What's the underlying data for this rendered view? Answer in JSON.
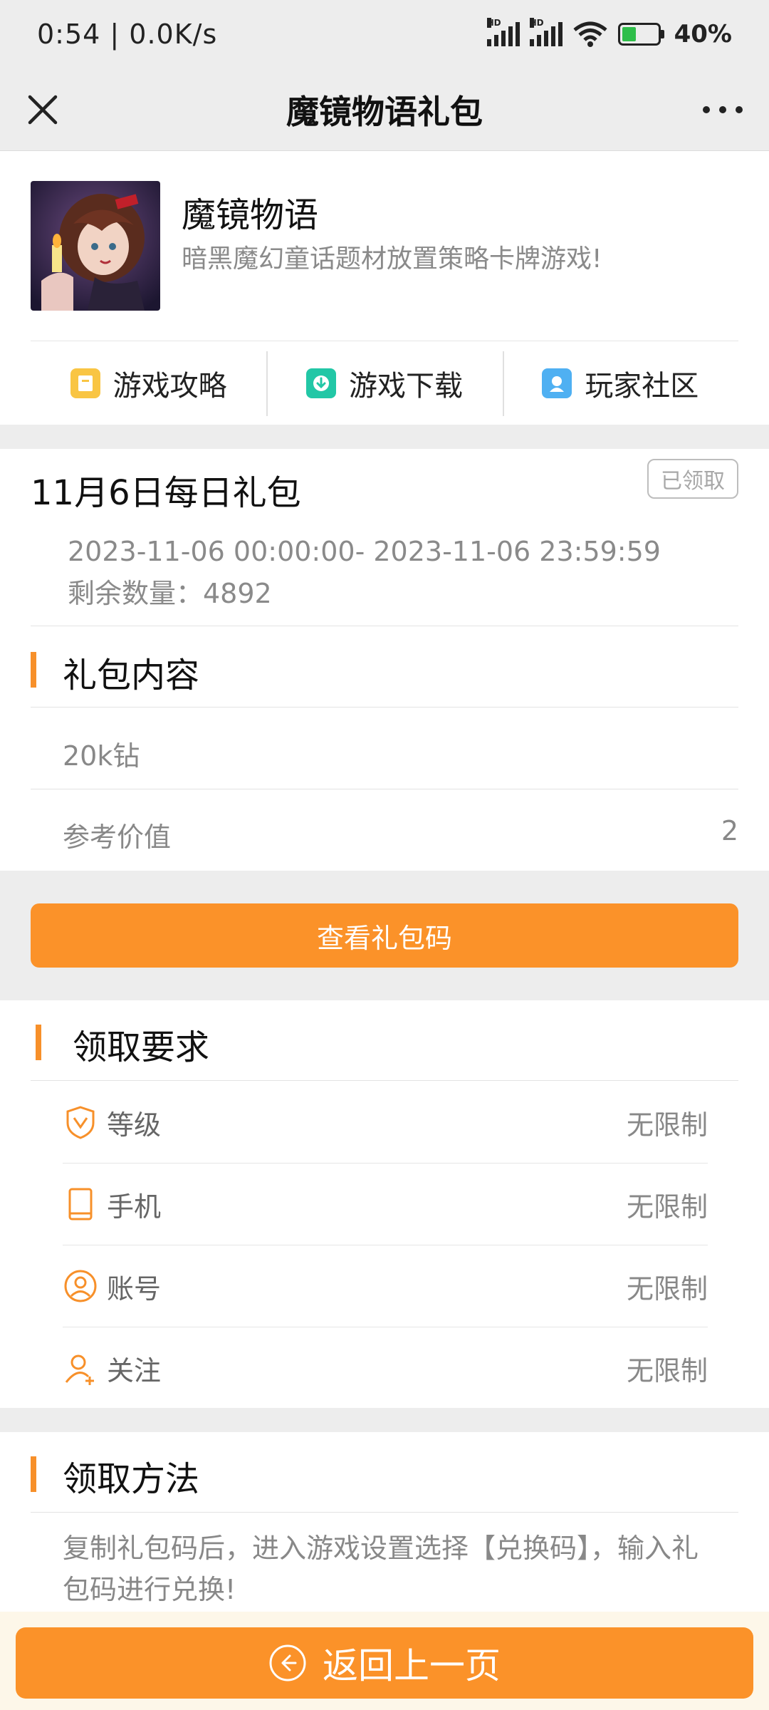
{
  "status_bar": {
    "time_speed": "0:54 | 0.0K/s",
    "signal1_label": "HD",
    "signal2_label": "HD",
    "battery_percent": "40%",
    "battery_level": 0.4
  },
  "header": {
    "title": "魔镜物语礼包"
  },
  "game": {
    "name": "魔镜物语",
    "description": "暗黑魔幻童话题材放置策略卡牌游戏!",
    "links": [
      {
        "label": "游戏攻略",
        "icon": "guide-icon",
        "color": "#f9c543"
      },
      {
        "label": "游戏下载",
        "icon": "download-icon",
        "color": "#22c7a6"
      },
      {
        "label": "玩家社区",
        "icon": "community-icon",
        "color": "#4fb0f2"
      }
    ]
  },
  "gift": {
    "title": "11月6日每日礼包",
    "status_badge": "已领取",
    "time_range": "2023-11-06 00:00:00- 2023-11-06 23:59:59",
    "remaining": "剩余数量：4892",
    "content_section_title": "礼包内容",
    "content_item": "20k钻",
    "ref_value_label": "参考价值",
    "ref_value": "2"
  },
  "view_code_button": "查看礼包码",
  "requirements": {
    "section_title": "领取要求",
    "rows": [
      {
        "label": "等级",
        "value": "无限制",
        "icon": "shield-v-icon"
      },
      {
        "label": "手机",
        "value": "无限制",
        "icon": "phone-icon"
      },
      {
        "label": "账号",
        "value": "无限制",
        "icon": "user-circle-icon"
      },
      {
        "label": "关注",
        "value": "无限制",
        "icon": "user-add-icon"
      }
    ]
  },
  "method": {
    "section_title": "领取方法",
    "text": "复制礼包码后，进入游戏设置选择【兑换码】，输入礼包码进行兑换!"
  },
  "back_button": "返回上一页",
  "accent_color": "#fb9229"
}
